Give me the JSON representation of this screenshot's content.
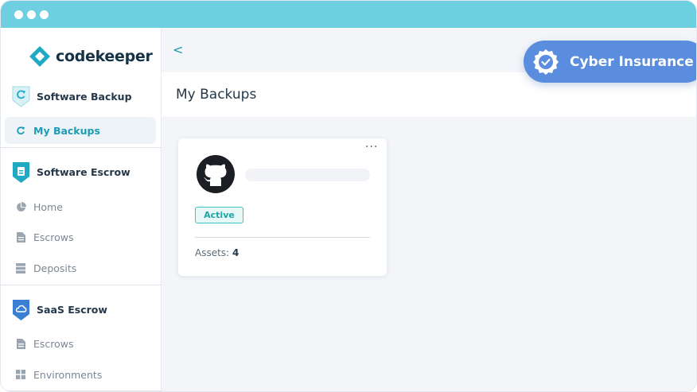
{
  "app": {
    "brand": "codekeeper"
  },
  "colors": {
    "accent": "#1b9db3",
    "titlebar": "#6ecfe0",
    "badge": "#5a8dde",
    "status": "#3ec4c4"
  },
  "sidebar": {
    "software_backup": {
      "title": "Software Backup",
      "icon": "backup-shield-icon",
      "items": [
        {
          "label": "My Backups",
          "icon": "refresh-icon",
          "active": true
        }
      ]
    },
    "software_escrow": {
      "title": "Software Escrow",
      "icon": "escrow-shield-icon",
      "items": [
        {
          "label": "Home",
          "icon": "pie-chart-icon"
        },
        {
          "label": "Escrows",
          "icon": "document-icon"
        },
        {
          "label": "Deposits",
          "icon": "server-icon"
        }
      ]
    },
    "saas_escrow": {
      "title": "SaaS Escrow",
      "icon": "cloud-shield-icon",
      "items": [
        {
          "label": "Escrows",
          "icon": "document-icon"
        },
        {
          "label": "Environments",
          "icon": "grid-icon"
        }
      ]
    }
  },
  "header": {
    "back_label": "<",
    "title": "My Backups"
  },
  "cyber_badge": {
    "label": "Cyber Insurance",
    "icon": "verified-seal-icon"
  },
  "card": {
    "provider_icon": "github-icon",
    "menu_label": "···",
    "status": "Active",
    "assets_label": "Assets:",
    "assets_count": "4"
  }
}
